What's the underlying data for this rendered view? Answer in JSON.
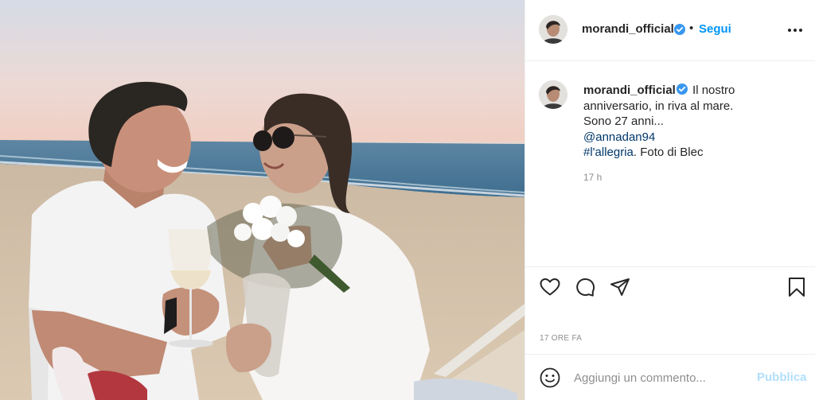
{
  "post": {
    "username": "morandi_official",
    "verified": true,
    "separator": "•",
    "follow_label": "Segui",
    "more_icon": "more-horizontal-icon",
    "photo": {
      "scene": "couple-on-beach-at-sunset",
      "sky_top_color": "#d9dde6",
      "sky_bottom_color": "#efd2c8",
      "sea_color": "#4e7fa0",
      "sand_color": "#d8c4ab"
    },
    "caption": {
      "username": "morandi_official",
      "parts": [
        "Il nostro",
        "anniversario, in riva al mare.",
        "Sono 27 anni..."
      ],
      "mention": "@annadan94",
      "hashtag": "#l'allegria",
      "suffix": ". Foto di Blec",
      "time": "17 h"
    },
    "actions": {
      "like_icon": "heart-icon",
      "comment_icon": "comment-icon",
      "share_icon": "share-icon",
      "save_icon": "bookmark-icon"
    },
    "timestamp": "17 ORE FA",
    "comment_box": {
      "emoji_icon": "emoji-icon",
      "placeholder": "Aggiungi un commento...",
      "publish_label": "Pubblica"
    },
    "colors": {
      "accent": "#0095f6",
      "verified": "#3897f0",
      "publish_disabled": "#b2dffc",
      "muted_text": "#8e8e8e"
    }
  }
}
